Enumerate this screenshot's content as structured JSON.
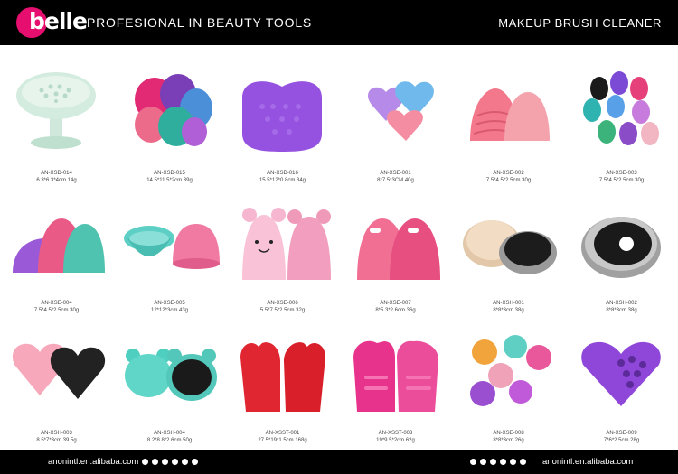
{
  "header": {
    "logo": "belle",
    "tagline": "PROFESIONAL IN BEAUTY TOOLS",
    "title": "MAKEUP BRUSH CLEANER"
  },
  "products": [
    {
      "code": "AN-XSD-014",
      "spec": "6.3*6.3*4cm 14g"
    },
    {
      "code": "AN-XSD-015",
      "spec": "14.5*11.5*2cm 39g"
    },
    {
      "code": "AN-XSD-016",
      "spec": "15.5*12*0.8cm 34g"
    },
    {
      "code": "AN-XSE-001",
      "spec": "8*7.5*3CM 40g"
    },
    {
      "code": "AN-XSE-002",
      "spec": "7.5*4.5*2.5cm 30g"
    },
    {
      "code": "AN-XSE-003",
      "spec": "7.5*4.5*2.5cm 30g"
    },
    {
      "code": "AN-XSE-004",
      "spec": "7.5*4.5*2.5cm 30g"
    },
    {
      "code": "AN-XSE-005",
      "spec": "12*12*3cm 43g"
    },
    {
      "code": "AN-XSE-006",
      "spec": "5.5*7.5*2.5cm 32g"
    },
    {
      "code": "AN-XSE-007",
      "spec": "8*5.3*2.6cm 36g"
    },
    {
      "code": "AN-XSH-001",
      "spec": "8*8*3cm 38g"
    },
    {
      "code": "AN-XSH-002",
      "spec": "8*8*3cm 38g"
    },
    {
      "code": "AN-XSH-003",
      "spec": "8.5*7*3cm  39.5g"
    },
    {
      "code": "AN-XSH-004",
      "spec": "8.2*8.8*2.6cm 50g"
    },
    {
      "code": "AN-XSST-001",
      "spec": "27.5*19*1.5cm 168g"
    },
    {
      "code": "AN-XSST-003",
      "spec": "19*9.5*2cm 62g"
    },
    {
      "code": "AN-XSE-008",
      "spec": "8*8*3cm 26g"
    },
    {
      "code": "AN-XSE-009",
      "spec": "7*6*2.5cm 28g"
    }
  ],
  "footer": {
    "url_left": "anonintl.en.alibaba.com",
    "url_right": "anonintl.en.alibaba.com"
  },
  "colors": {
    "brand": "#e60e6e",
    "background": "#000000",
    "text": "#ffffff"
  }
}
